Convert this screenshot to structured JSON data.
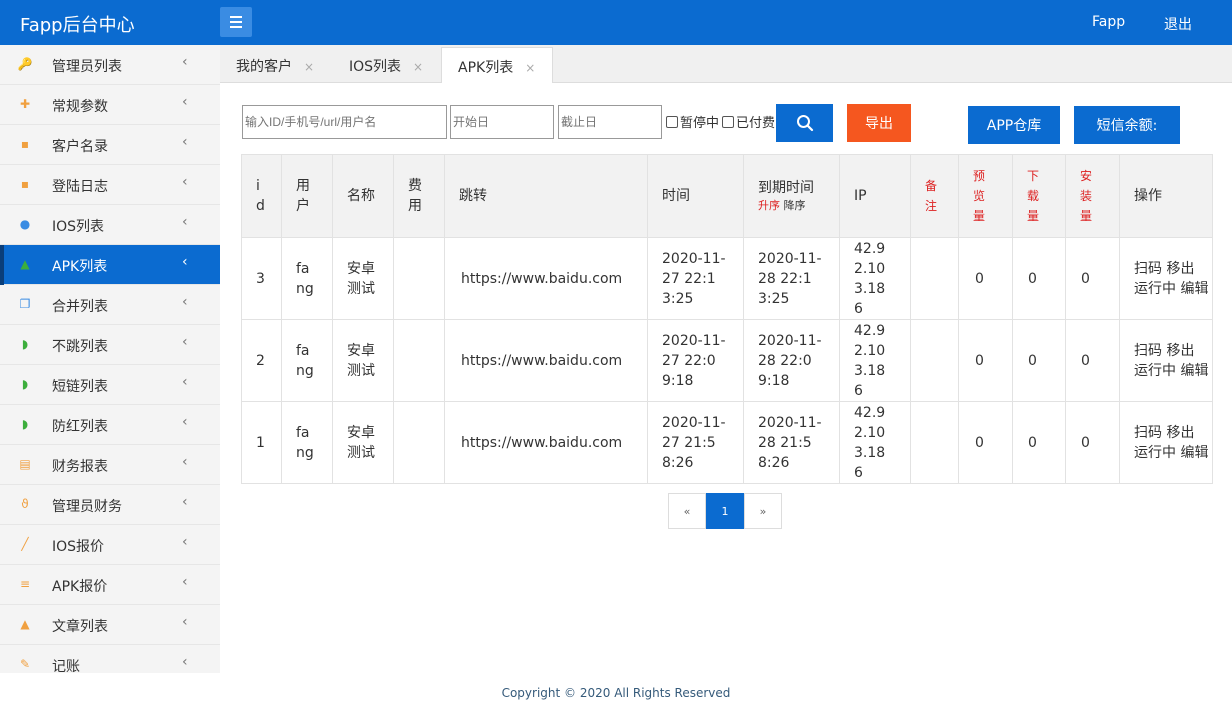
{
  "app": {
    "title": "Fapp后台中心",
    "user": "Fapp",
    "logout": "退出"
  },
  "sidebar": {
    "items": [
      {
        "label": "管理员列表",
        "icon": "key-icon",
        "active": false
      },
      {
        "label": "常规参数",
        "icon": "plus-icon",
        "active": false
      },
      {
        "label": "客户名录",
        "icon": "briefcase-icon",
        "active": false
      },
      {
        "label": "登陆日志",
        "icon": "briefcase-icon",
        "active": false
      },
      {
        "label": "IOS列表",
        "icon": "apple-icon",
        "active": false
      },
      {
        "label": "APK列表",
        "icon": "android-icon",
        "active": true
      },
      {
        "label": "合并列表",
        "icon": "copy-icon",
        "active": false
      },
      {
        "label": "不跳列表",
        "icon": "rss-icon",
        "active": false
      },
      {
        "label": "短链列表",
        "icon": "rss-icon",
        "active": false
      },
      {
        "label": "防红列表",
        "icon": "rss-icon",
        "active": false
      },
      {
        "label": "财务报表",
        "icon": "files-icon",
        "active": false
      },
      {
        "label": "管理员财务",
        "icon": "stethoscope-icon",
        "active": false
      },
      {
        "label": "IOS报价",
        "icon": "wand-icon",
        "active": false
      },
      {
        "label": "APK报价",
        "icon": "list-icon",
        "active": false
      },
      {
        "label": "文章列表",
        "icon": "flask-icon",
        "active": false
      },
      {
        "label": "记账",
        "icon": "pencil-icon",
        "active": false
      }
    ]
  },
  "tabs": [
    {
      "label": "我的客户",
      "close": "×"
    },
    {
      "label": "IOS列表",
      "close": "×"
    },
    {
      "label": "APK列表",
      "close": "×"
    }
  ],
  "filters": {
    "search_placeholder": "输入ID/手机号/url/用户名",
    "start_placeholder": "开始日",
    "end_placeholder": "截止日",
    "paused_label": "暂停中",
    "paid_label": "已付费",
    "export_label": "导出",
    "app_store_label": "APP仓库",
    "sms_label": "短信余额:"
  },
  "table": {
    "headers": {
      "id": "id",
      "user": "用户",
      "name": "名称",
      "fee": "费用",
      "redirect": "跳转",
      "time": "时间",
      "expire": "到期时间",
      "sort_asc": "升序",
      "sort_desc": "降序",
      "ip": "IP",
      "note": "备注",
      "preview": "预览量",
      "download": "下载量",
      "install": "安装量",
      "ops": "操作"
    },
    "rows": [
      {
        "id": "3",
        "user": "fang",
        "name": "安卓测试",
        "fee": "",
        "url": "https://www.baidu.com",
        "time": "2020-11-27 22:13:25",
        "expire": "2020-11-28 22:13:25",
        "ip": "42.92.103.186",
        "note": "",
        "preview": "0",
        "download": "0",
        "install": "0",
        "op_scan": "扫码",
        "op_remove": "移出",
        "op_status": "运行中",
        "op_edit": "编辑"
      },
      {
        "id": "2",
        "user": "fang",
        "name": "安卓测试",
        "fee": "",
        "url": "https://www.baidu.com",
        "time": "2020-11-27 22:09:18",
        "expire": "2020-11-28 22:09:18",
        "ip": "42.92.103.186",
        "note": "",
        "preview": "0",
        "download": "0",
        "install": "0",
        "op_scan": "扫码",
        "op_remove": "移出",
        "op_status": "运行中",
        "op_edit": "编辑"
      },
      {
        "id": "1",
        "user": "fang",
        "name": "安卓测试",
        "fee": "",
        "url": "https://www.baidu.com",
        "time": "2020-11-27 21:58:26",
        "expire": "2020-11-28 21:58:26",
        "ip": "42.92.103.186",
        "note": "",
        "preview": "0",
        "download": "0",
        "install": "0",
        "op_scan": "扫码",
        "op_remove": "移出",
        "op_status": "运行中",
        "op_edit": "编辑"
      }
    ]
  },
  "pagination": {
    "prev": "«",
    "current": "1",
    "next": "»"
  },
  "footer": {
    "text": "Copyright © 2020 All Rights Reserved"
  },
  "colors": {
    "primary": "#0b6bd0",
    "export": "#f5571f",
    "danger_text": "#dd2222"
  }
}
